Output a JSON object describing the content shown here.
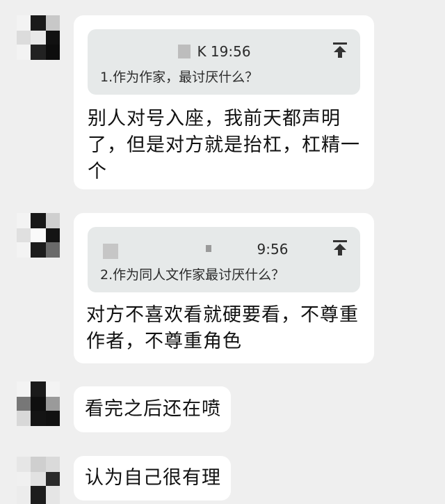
{
  "messages": [
    {
      "quote_time": "K 19:56",
      "quote_text": "1.作为作家，最讨厌什么？",
      "text": "别人对号入座，我前天都声明了，但是对方就是抬杠，杠精一个"
    },
    {
      "quote_time": "9:56",
      "quote_text": "2.作为同人文作家最讨厌什么？",
      "text": "对方不喜欢看就硬要看，不尊重作者，不尊重角色"
    },
    {
      "text": "看完之后还在喷"
    },
    {
      "text": "认为自己很有理"
    }
  ],
  "icons": {
    "pin": "pin-to-top-icon"
  },
  "colors": {
    "background": "#efefef",
    "bubble": "#ffffff",
    "quote_bg": "#e6e9e9"
  }
}
